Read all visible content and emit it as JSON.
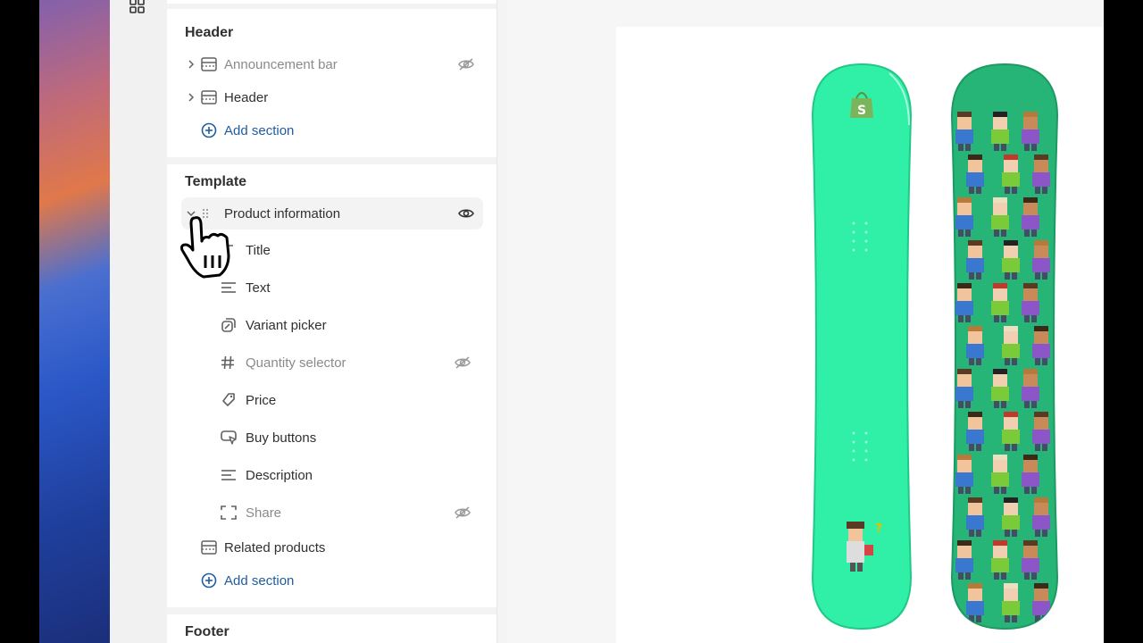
{
  "header_group": {
    "title": "Header",
    "items": [
      {
        "label": "Announcement bar",
        "hidden": true
      },
      {
        "label": "Header",
        "hidden": false
      }
    ],
    "add_label": "Add section"
  },
  "template_group": {
    "title": "Template",
    "section": {
      "label": "Product information",
      "expanded": true
    },
    "blocks": [
      {
        "label": "Title",
        "icon": "title-icon"
      },
      {
        "label": "Text",
        "icon": "text-lines-icon"
      },
      {
        "label": "Variant picker",
        "icon": "variant-picker-icon"
      },
      {
        "label": "Quantity selector",
        "icon": "hash-icon",
        "hidden": true
      },
      {
        "label": "Price",
        "icon": "price-tag-icon"
      },
      {
        "label": "Buy buttons",
        "icon": "buy-button-icon"
      },
      {
        "label": "Description",
        "icon": "text-lines-icon"
      },
      {
        "label": "Share",
        "icon": "share-frame-icon",
        "hidden": true
      }
    ],
    "related": "Related products",
    "add_label": "Add section"
  },
  "footer_group": {
    "title": "Footer"
  },
  "colors": {
    "link": "#1f5da0",
    "board_left": "#2ff0a6",
    "board_right": "#26b576"
  }
}
